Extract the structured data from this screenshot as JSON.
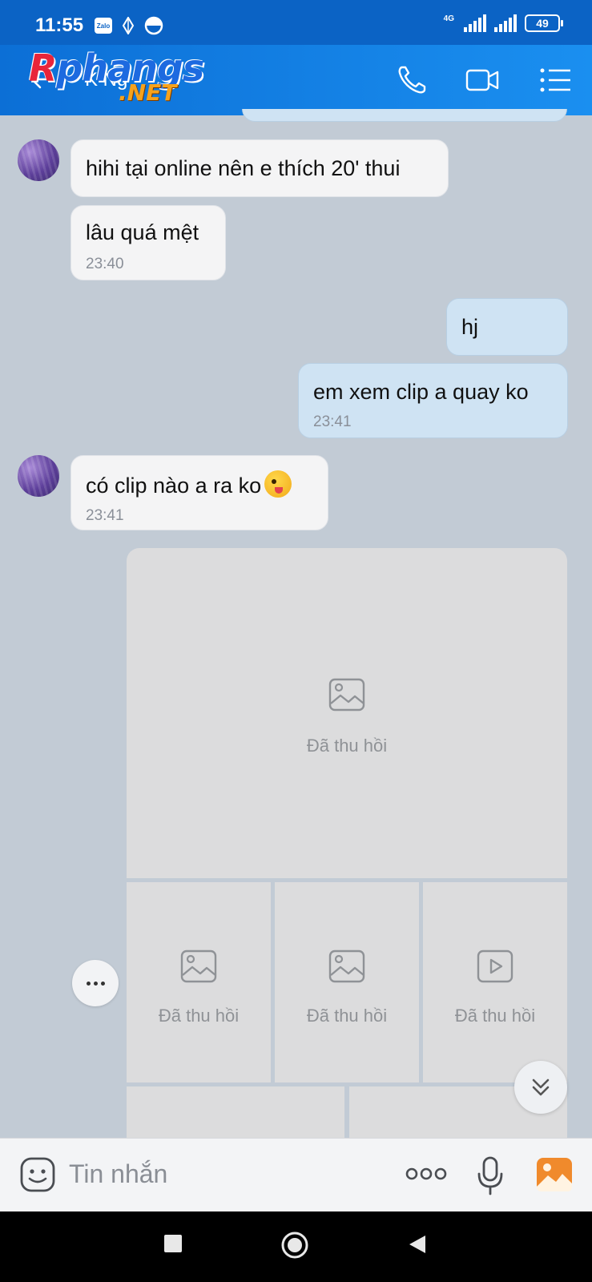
{
  "status_bar": {
    "time": "11:55",
    "zalo_badge": "Zalo",
    "network_label": "4G",
    "battery": "49"
  },
  "header": {
    "contact_name": "K Ng",
    "watermark_main_a": "R",
    "watermark_main_b": "phangs",
    "watermark_sub": ".NET",
    "icons": [
      "back-arrow-icon",
      "phone-icon",
      "video-call-icon",
      "menu-list-icon"
    ]
  },
  "messages": [
    {
      "direction": "incoming",
      "text": "hihi tại online nên e thích 20' thui",
      "time": ""
    },
    {
      "direction": "incoming",
      "text": "lâu quá mệt",
      "time": "23:40"
    },
    {
      "direction": "outgoing",
      "text": "hj",
      "time": ""
    },
    {
      "direction": "outgoing",
      "text": "em xem clip a quay ko",
      "time": "23:41"
    },
    {
      "direction": "incoming",
      "text": "có clip nào a ra ko",
      "time": "23:41",
      "emoji": "winking-face-tongue"
    }
  ],
  "media_grid": {
    "recalled_label": "Đã thu hồi",
    "items": [
      {
        "type": "image",
        "label": "Đã thu hồi"
      },
      {
        "type": "image",
        "label": "Đã thu hồi"
      },
      {
        "type": "image",
        "label": "Đã thu hồi"
      },
      {
        "type": "video",
        "label": "Đã thu hồi"
      }
    ]
  },
  "input_bar": {
    "placeholder": "Tin nhắn",
    "icons": [
      "sticker-icon",
      "more-options-icon",
      "microphone-icon",
      "gallery-icon"
    ]
  },
  "colors": {
    "header": "#0c6fd6",
    "chat_background": "#c2cbd5",
    "incoming_bubble": "#f4f4f5",
    "outgoing_bubble": "#cfe3f3",
    "gallery_accent": "#f08a2c"
  }
}
